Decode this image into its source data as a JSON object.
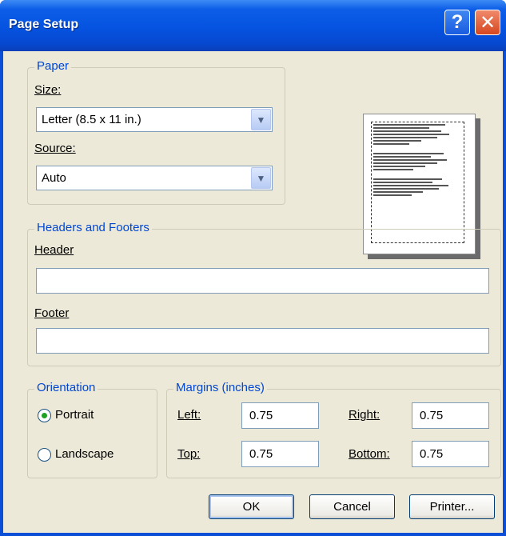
{
  "window": {
    "title": "Page Setup",
    "help_glyph": "?",
    "close_glyph": "✕"
  },
  "paper": {
    "legend": "Paper",
    "size_label": "Size:",
    "size_value": "Letter (8.5 x 11 in.)",
    "source_label": "Source:",
    "source_value": "Auto"
  },
  "headers_footers": {
    "legend": "Headers and Footers",
    "header_label": "Header",
    "header_value": "",
    "footer_label": "Footer",
    "footer_value": ""
  },
  "orientation": {
    "legend": "Orientation",
    "portrait_label": "Portrait",
    "landscape_label": "Landscape",
    "selected": "Portrait"
  },
  "margins": {
    "legend": "Margins (inches)",
    "left_label": "Left:",
    "left_value": "0.75",
    "right_label": "Right:",
    "right_value": "0.75",
    "top_label": "Top:",
    "top_value": "0.75",
    "bottom_label": "Bottom:",
    "bottom_value": "0.75"
  },
  "buttons": {
    "ok": "OK",
    "cancel": "Cancel",
    "printer": "Printer..."
  },
  "icons": {
    "dropdown": "chevron-down-icon",
    "help": "help-icon",
    "close": "close-icon"
  },
  "colors": {
    "title_bar": "#0553e0",
    "legend_text": "#0046d5",
    "dialog_face": "#ece9d8"
  }
}
